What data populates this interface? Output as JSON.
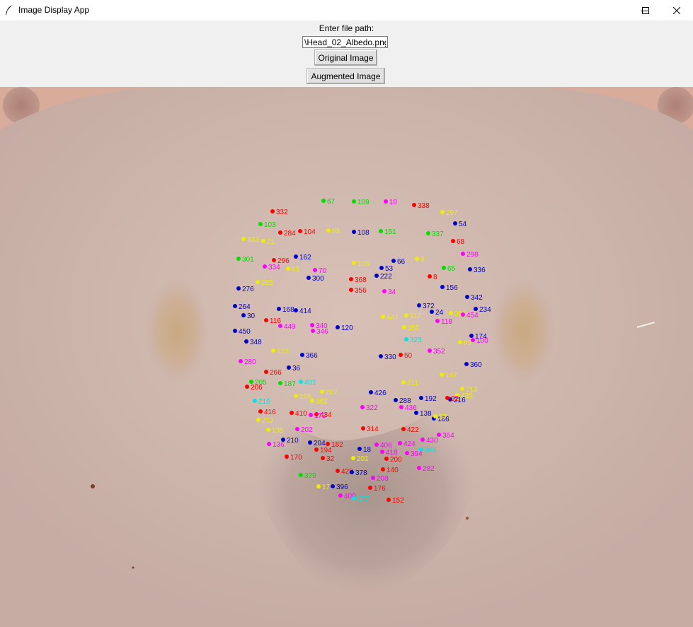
{
  "window": {
    "title": "Image Display App",
    "app_icon": "feather-icon",
    "controls": [
      "minimize-icon",
      "maximize-icon",
      "close-icon"
    ]
  },
  "form": {
    "prompt": "Enter file path:",
    "path_value": "\\Head_02_Albedo.png",
    "original_button": "Original Image",
    "augmented_button": "Augmented Image"
  },
  "image": {
    "landmark_labels": [
      {
        "t": "67",
        "c": "#00dd00"
      },
      {
        "t": "109",
        "c": "#00dd00"
      },
      {
        "t": "10",
        "c": "#ff00ff"
      },
      {
        "t": "338",
        "c": "#ff0000"
      },
      {
        "t": "297",
        "c": "#eeee00"
      },
      {
        "t": "332",
        "c": "#ff0000"
      },
      {
        "t": "103",
        "c": "#00dd00"
      },
      {
        "t": "54",
        "c": "#0000cc"
      },
      {
        "t": "284",
        "c": "#ff0000"
      },
      {
        "t": "104",
        "c": "#ff0000"
      },
      {
        "t": "69",
        "c": "#eeee00"
      },
      {
        "t": "108",
        "c": "#0000cc"
      },
      {
        "t": "151",
        "c": "#00dd00"
      },
      {
        "t": "337",
        "c": "#00dd00"
      },
      {
        "t": "333",
        "c": "#eeee00"
      },
      {
        "t": "21",
        "c": "#eeee00"
      },
      {
        "t": "68",
        "c": "#ff0000"
      },
      {
        "t": "298",
        "c": "#ff00ff"
      },
      {
        "t": "301",
        "c": "#00dd00"
      },
      {
        "t": "162",
        "c": "#0000cc"
      },
      {
        "t": "105",
        "c": "#eeee00"
      },
      {
        "t": "66",
        "c": "#0000cc"
      },
      {
        "t": "9",
        "c": "#eeee00"
      },
      {
        "t": "296",
        "c": "#ff0000"
      },
      {
        "t": "334",
        "c": "#ff00ff"
      },
      {
        "t": "63",
        "c": "#eeee00"
      },
      {
        "t": "70",
        "c": "#ff00ff"
      },
      {
        "t": "53",
        "c": "#0000cc"
      },
      {
        "t": "65",
        "c": "#00dd00"
      },
      {
        "t": "336",
        "c": "#0000cc"
      },
      {
        "t": "300",
        "c": "#0000cc"
      },
      {
        "t": "368",
        "c": "#ff0000"
      },
      {
        "t": "222",
        "c": "#0000cc"
      },
      {
        "t": "8",
        "c": "#ff0000"
      },
      {
        "t": "285",
        "c": "#eeee00"
      },
      {
        "t": "276",
        "c": "#0000cc"
      },
      {
        "t": "156",
        "c": "#0000cc"
      },
      {
        "t": "356",
        "c": "#ff0000"
      },
      {
        "t": "34",
        "c": "#ff00ff"
      },
      {
        "t": "342",
        "c": "#0000cc"
      },
      {
        "t": "264",
        "c": "#0000cc"
      },
      {
        "t": "168",
        "c": "#0000cc"
      },
      {
        "t": "414",
        "c": "#0000cc"
      },
      {
        "t": "372",
        "c": "#0000cc"
      },
      {
        "t": "234",
        "c": "#0000cc"
      },
      {
        "t": "30",
        "c": "#0000cc"
      },
      {
        "t": "24",
        "c": "#0000cc"
      },
      {
        "t": "261",
        "c": "#eeee00"
      },
      {
        "t": "454",
        "c": "#ff00ff"
      },
      {
        "t": "116",
        "c": "#ff0000"
      },
      {
        "t": "449",
        "c": "#ff00ff"
      },
      {
        "t": "340",
        "c": "#ff00ff"
      },
      {
        "t": "447",
        "c": "#eeee00"
      },
      {
        "t": "117",
        "c": "#eeee00"
      },
      {
        "t": "118",
        "c": "#ff00ff"
      },
      {
        "t": "120",
        "c": "#0000cc"
      },
      {
        "t": "350",
        "c": "#eeee00"
      },
      {
        "t": "450",
        "c": "#0000cc"
      },
      {
        "t": "346",
        "c": "#ff00ff"
      },
      {
        "t": "174",
        "c": "#0000cc"
      },
      {
        "t": "348",
        "c": "#0000cc"
      },
      {
        "t": "93",
        "c": "#eeee00"
      },
      {
        "t": "100",
        "c": "#ff00ff"
      },
      {
        "t": "323",
        "c": "#00e5e5"
      },
      {
        "t": "123",
        "c": "#eeee00"
      },
      {
        "t": "352",
        "c": "#ff00ff"
      },
      {
        "t": "366",
        "c": "#0000cc"
      },
      {
        "t": "330",
        "c": "#0000cc"
      },
      {
        "t": "50",
        "c": "#ff0000"
      },
      {
        "t": "280",
        "c": "#ff00ff"
      },
      {
        "t": "36",
        "c": "#0000cc"
      },
      {
        "t": "360",
        "c": "#0000cc"
      },
      {
        "t": "266",
        "c": "#ff0000"
      },
      {
        "t": "147",
        "c": "#eeee00"
      },
      {
        "t": "205",
        "c": "#00dd00"
      },
      {
        "t": "401",
        "c": "#00e5e5"
      },
      {
        "t": "187",
        "c": "#00dd00"
      },
      {
        "t": "411",
        "c": "#eeee00"
      },
      {
        "t": "213",
        "c": "#eeee00"
      },
      {
        "t": "206",
        "c": "#ff0000"
      },
      {
        "t": "207",
        "c": "#eeee00"
      },
      {
        "t": "426",
        "c": "#0000cc"
      },
      {
        "t": "435",
        "c": "#eeee00"
      },
      {
        "t": "215",
        "c": "#00e5e5"
      },
      {
        "t": "165",
        "c": "#eeee00"
      },
      {
        "t": "393",
        "c": "#eeee00"
      },
      {
        "t": "288",
        "c": "#0000cc"
      },
      {
        "t": "192",
        "c": "#0000cc"
      },
      {
        "t": "216",
        "c": "#0000cc"
      },
      {
        "t": "92",
        "c": "#ff0000"
      },
      {
        "t": "322",
        "c": "#ff00ff"
      },
      {
        "t": "436",
        "c": "#ff00ff"
      },
      {
        "t": "416",
        "c": "#ff0000"
      },
      {
        "t": "410",
        "c": "#ff0000"
      },
      {
        "t": "186",
        "c": "#0000cc"
      },
      {
        "t": "138",
        "c": "#0000cc"
      },
      {
        "t": "434",
        "c": "#ff0000"
      },
      {
        "t": "212",
        "c": "#eeee00"
      },
      {
        "t": "57",
        "c": "#eeee00"
      },
      {
        "t": "172",
        "c": "#ff00ff"
      },
      {
        "t": "135",
        "c": "#eeee00"
      },
      {
        "t": "202",
        "c": "#ff00ff"
      },
      {
        "t": "314",
        "c": "#ff0000"
      },
      {
        "t": "422",
        "c": "#ff0000"
      },
      {
        "t": "364",
        "c": "#ff00ff"
      },
      {
        "t": "210",
        "c": "#0000cc"
      },
      {
        "t": "204",
        "c": "#0000cc"
      },
      {
        "t": "182",
        "c": "#ff0000"
      },
      {
        "t": "430",
        "c": "#ff00ff"
      },
      {
        "t": "136",
        "c": "#ff00ff"
      },
      {
        "t": "406",
        "c": "#ff00ff"
      },
      {
        "t": "424",
        "c": "#ff00ff"
      },
      {
        "t": "365",
        "c": "#00e5e5"
      },
      {
        "t": "194",
        "c": "#ff0000"
      },
      {
        "t": "18",
        "c": "#0000cc"
      },
      {
        "t": "418",
        "c": "#ff00ff"
      },
      {
        "t": "394",
        "c": "#ff00ff"
      },
      {
        "t": "170",
        "c": "#ff0000"
      },
      {
        "t": "32",
        "c": "#ff0000"
      },
      {
        "t": "201",
        "c": "#eeee00"
      },
      {
        "t": "200",
        "c": "#ff0000"
      },
      {
        "t": "282",
        "c": "#ff00ff"
      },
      {
        "t": "379",
        "c": "#00dd00"
      },
      {
        "t": "140",
        "c": "#ff0000"
      },
      {
        "t": "208",
        "c": "#ff00ff"
      },
      {
        "t": "428",
        "c": "#ff0000"
      },
      {
        "t": "378",
        "c": "#0000cc"
      },
      {
        "t": "171",
        "c": "#eeee00"
      },
      {
        "t": "176",
        "c": "#ff0000"
      },
      {
        "t": "396",
        "c": "#0000cc"
      },
      {
        "t": "400",
        "c": "#ff00ff"
      },
      {
        "t": "377",
        "c": "#00e5e5"
      },
      {
        "t": "152",
        "c": "#ff0000"
      }
    ]
  }
}
